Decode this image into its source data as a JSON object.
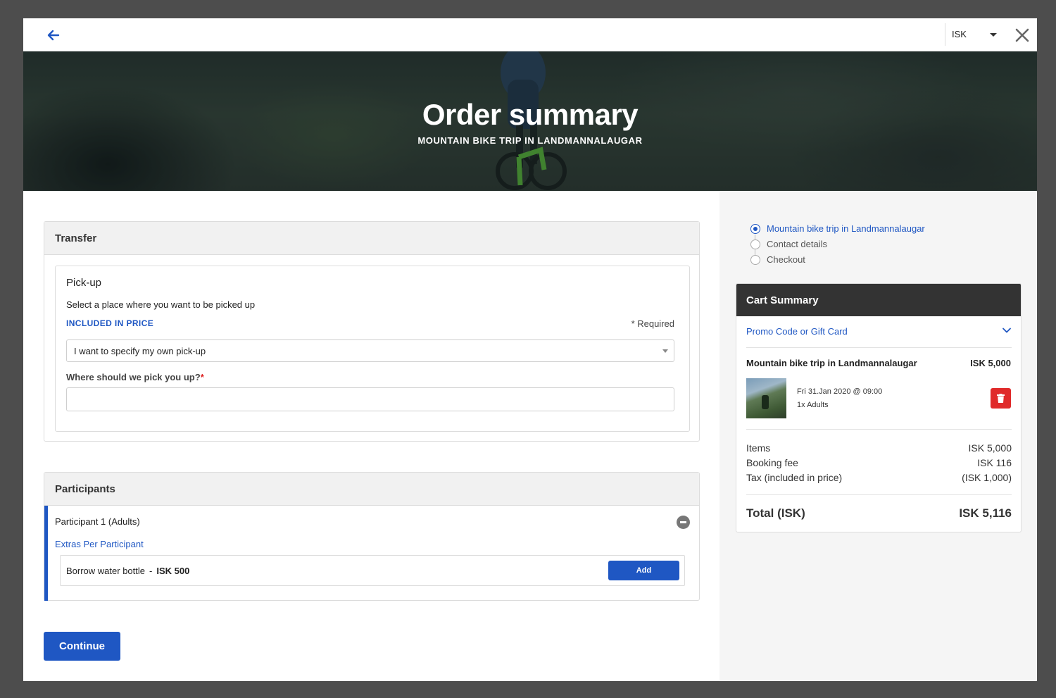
{
  "header": {
    "currency": "ISK"
  },
  "hero": {
    "title": "Order summary",
    "subtitle": "MOUNTAIN BIKE TRIP IN LANDMANNALAUGAR"
  },
  "transfer": {
    "heading": "Transfer",
    "pickup_title": "Pick-up",
    "pickup_description": "Select a place where you want to be picked up",
    "included_label": "INCLUDED IN PRICE",
    "required_label": "* Required",
    "select_value": "I want to specify my own pick-up",
    "where_label": "Where should we pick you up?",
    "where_required": "*",
    "where_value": "",
    "where_placeholder": ""
  },
  "participants": {
    "heading": "Participants",
    "participant_label": "Participant 1 (Adults)",
    "extras_label": "Extras Per Participant",
    "extra_name": "Borrow water bottle",
    "extra_separator": "-",
    "extra_price": "ISK 500",
    "add_label": "Add"
  },
  "continue_label": "Continue",
  "steps": [
    {
      "label": "Mountain bike trip in Landmannalaugar",
      "active": true
    },
    {
      "label": "Contact details",
      "active": false
    },
    {
      "label": "Checkout",
      "active": false
    }
  ],
  "cart": {
    "heading": "Cart Summary",
    "promo_label": "Promo Code or Gift Card",
    "item_title": "Mountain bike trip in Landmannalaugar",
    "item_price": "ISK 5,000",
    "item_date": "Fri 31.Jan 2020 @ 09:00",
    "item_qty": "1x Adults",
    "items_label": "Items",
    "items_value": "ISK 5,000",
    "fee_label": "Booking fee",
    "fee_value": "ISK 116",
    "tax_label": "Tax (included in price)",
    "tax_value": "(ISK 1,000)",
    "total_label": "Total (ISK)",
    "total_value": "ISK 5,116"
  },
  "colors": {
    "accent": "#1f57c3",
    "danger": "#e02a2a",
    "cart_header": "#333333",
    "backdrop": "#4d4d4d"
  },
  "icons": [
    "back-arrow-icon",
    "caret-down-icon",
    "close-icon",
    "minus-circle-icon",
    "chevron-down-icon",
    "trash-icon"
  ]
}
